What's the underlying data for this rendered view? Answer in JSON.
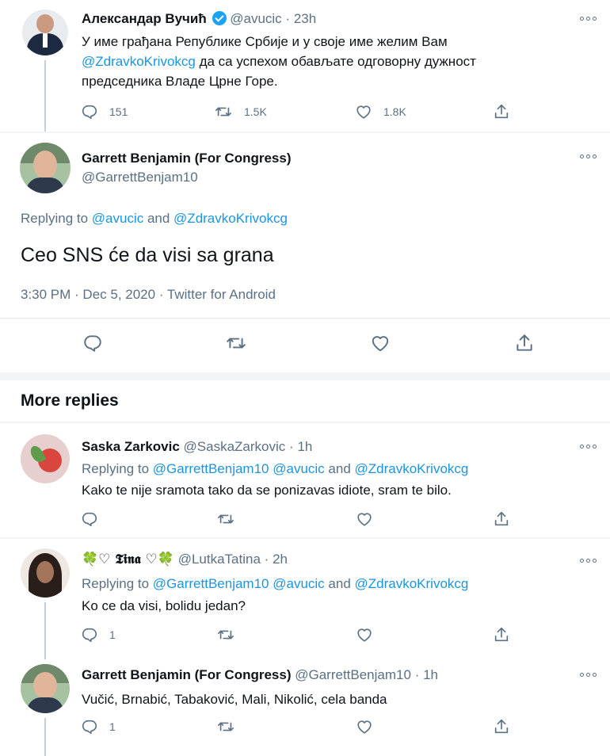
{
  "tweet1": {
    "name": "Александар Вучић",
    "handle": "@avucic",
    "time": "23h",
    "dot": "·",
    "line1": "У име грађана Републике Србије и у своје име желим Вам",
    "mention": "@ZdravkoKrivokcg",
    "line2_rest": " да са успехом обављате одговорну дужност",
    "line3": "председника Владе Црне Горе.",
    "replies": "151",
    "retweets": "1.5K",
    "likes": "1.8K"
  },
  "main_tweet": {
    "name": "Garrett Benjamin (For Congress)",
    "handle": "@GarrettBenjam10",
    "replying_prefix": "Replying to ",
    "reply_to_1": "@avucic",
    "reply_and": " and ",
    "reply_to_2": "@ZdravkoKrivokcg",
    "text": "Ceo SNS će da visi sa grana",
    "meta": "3:30 PM · Dec 5, 2020 · Twitter for Android"
  },
  "more_replies": {
    "title": "More replies"
  },
  "reply1": {
    "name": "Saska Zarkovic",
    "handle": "@SaskaZarkovic",
    "time": "1h",
    "dot": "·",
    "replying_prefix": "Replying to ",
    "reply_to_1": "@GarrettBenjam10",
    "reply_to_2": "@avucic",
    "reply_and": " and ",
    "reply_to_3": "@ZdravkoKrivokcg",
    "text": "Kako te nije sramota tako da se ponizavas idiote, sram te bilo."
  },
  "reply2": {
    "name": "🍀♡ 𝕿𝖎𝖓𝖆 ♡🍀",
    "handle": "@LutkaTatina",
    "time": "2h",
    "dot": "·",
    "replying_prefix": "Replying to ",
    "reply_to_1": "@GarrettBenjam10",
    "reply_to_2": "@avucic",
    "reply_and": " and ",
    "reply_to_3": "@ZdravkoKrivokcg",
    "text": "Ko ce da visi, bolidu jedan?",
    "replies": "1"
  },
  "reply3": {
    "name": "Garrett Benjamin (For Congress)",
    "handle": "@GarrettBenjam10",
    "time": "1h",
    "dot": "·",
    "text": "Vučić, Brnabić, Tabaković, Mali, Nikolić, cela banda",
    "replies": "1"
  },
  "colors": {
    "link": "#1b95e0",
    "muted": "#5b7083",
    "verified": "#1da1f2"
  },
  "icons": [
    "verified-badge-icon",
    "more-icon",
    "reply-icon",
    "retweet-icon",
    "like-icon",
    "share-icon"
  ]
}
